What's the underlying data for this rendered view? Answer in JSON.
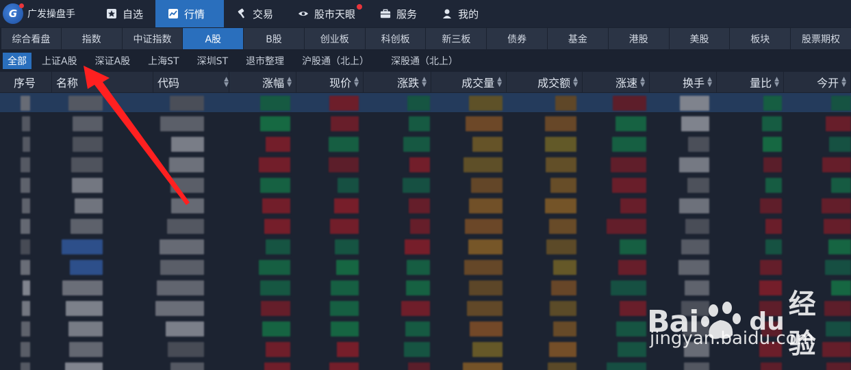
{
  "topbar": {
    "brand": "广发操盘手",
    "logo_text": "G",
    "items": [
      {
        "label": "自选",
        "icon": "star-icon"
      },
      {
        "label": "行情",
        "icon": "chart-icon",
        "active": true
      },
      {
        "label": "交易",
        "icon": "hammer-icon"
      },
      {
        "label": "股市天眼",
        "icon": "eye-icon",
        "badge": true
      },
      {
        "label": "服务",
        "icon": "briefcase-icon"
      },
      {
        "label": "我的",
        "icon": "user-icon"
      }
    ]
  },
  "tabs": [
    {
      "label": "综合看盘"
    },
    {
      "label": "指数"
    },
    {
      "label": "中证指数"
    },
    {
      "label": "A股",
      "active": true
    },
    {
      "label": "B股"
    },
    {
      "label": "创业板"
    },
    {
      "label": "科创板"
    },
    {
      "label": "新三板"
    },
    {
      "label": "债券"
    },
    {
      "label": "基金"
    },
    {
      "label": "港股"
    },
    {
      "label": "美股"
    },
    {
      "label": "板块"
    },
    {
      "label": "股票期权"
    }
  ],
  "subtabs": [
    {
      "label": "全部",
      "active": true
    },
    {
      "label": "上证A股"
    },
    {
      "label": "深证A股"
    },
    {
      "label": "上海ST"
    },
    {
      "label": "深圳ST"
    },
    {
      "label": "退市整理"
    },
    {
      "label": "沪股通（北上）"
    },
    {
      "label": "深股通（北上）"
    }
  ],
  "table": {
    "columns": [
      "序号",
      "名称",
      "代码",
      "涨幅",
      "现价",
      "涨跌",
      "成交量",
      "成交额",
      "涨速",
      "换手",
      "量比",
      "今开"
    ]
  },
  "watermark": {
    "bai": "Bai",
    "du": "du",
    "cn": "经验",
    "url": "jingyan.baidu.com"
  },
  "colors": {
    "accent": "#2a6fbd",
    "background": "#1b2230",
    "badge": "#e8353b",
    "arrow": "#ff2020"
  }
}
